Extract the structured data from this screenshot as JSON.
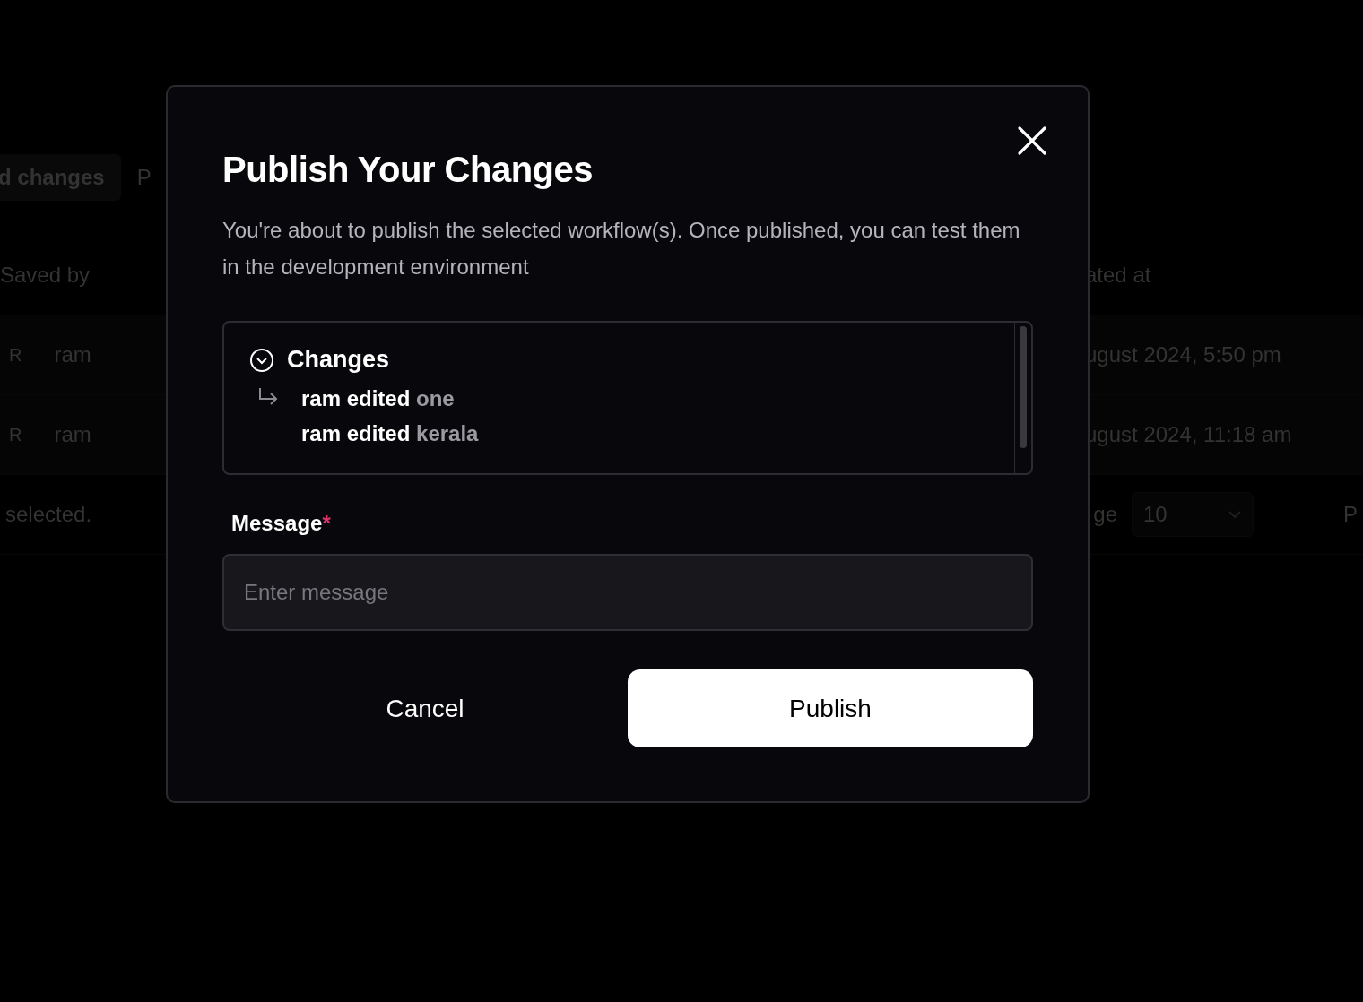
{
  "background": {
    "tabs": [
      {
        "label": "d changes",
        "selected": true
      },
      {
        "label": "P",
        "selected": false
      }
    ],
    "columns": [
      "Saved by",
      "ated at"
    ],
    "rows": [
      {
        "avatar": "R",
        "saved_by": "ram",
        "updated_at": "ugust 2024, 5:50 pm"
      },
      {
        "avatar": "R",
        "saved_by": "ram",
        "updated_at": "ugust 2024, 11:18 am"
      }
    ],
    "footer": {
      "selection": "selected.",
      "page_size_label": "ge",
      "page_size": "10",
      "page_label": "P"
    }
  },
  "dialog": {
    "title": "Publish Your Changes",
    "description": "You're about to publish the selected workflow(s). Once published, you can test them in the development environment",
    "changes": {
      "title": "Changes",
      "expanded": true,
      "items": [
        {
          "actor": "ram edited",
          "target": "one"
        },
        {
          "actor": "ram edited",
          "target": "kerala"
        }
      ]
    },
    "message": {
      "label": "Message",
      "required": true,
      "required_mark": "*",
      "placeholder": "Enter message"
    },
    "buttons": [
      {
        "kind": "secondary",
        "label": "Cancel"
      },
      {
        "kind": "primary",
        "label": "Publish"
      }
    ]
  }
}
